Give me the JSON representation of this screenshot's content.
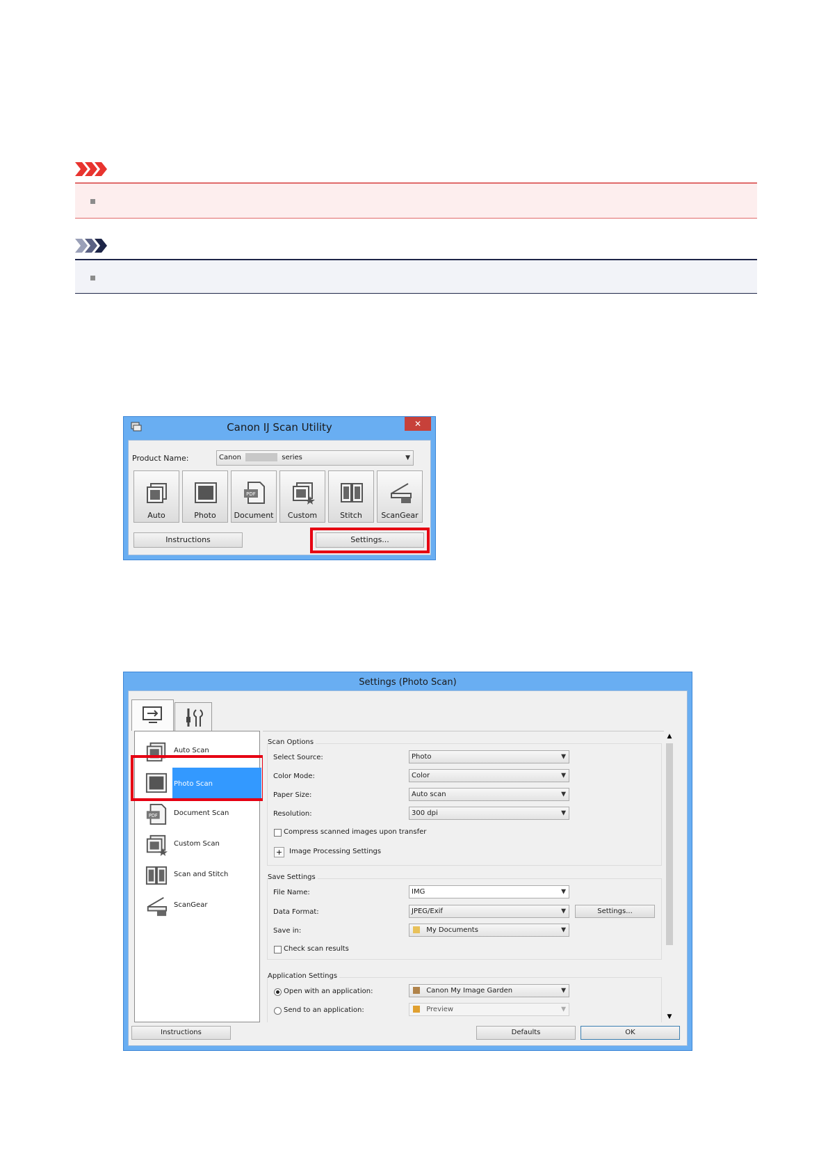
{
  "notices": {
    "important_icon": "important-arrows-icon",
    "note_icon": "note-arrows-icon",
    "important_color": "#e8342f",
    "note_color": "#1d2548"
  },
  "scan_utility": {
    "title": "Canon IJ Scan Utility",
    "close_glyph": "✕",
    "product_name_label": "Product Name:",
    "product_value_prefix": "Canon",
    "product_value_suffix": "series",
    "tiles": [
      {
        "label": "Auto",
        "icon": "auto-scan-icon"
      },
      {
        "label": "Photo",
        "icon": "photo-scan-icon"
      },
      {
        "label": "Document",
        "icon": "document-scan-icon"
      },
      {
        "label": "Custom",
        "icon": "custom-scan-icon"
      },
      {
        "label": "Stitch",
        "icon": "stitch-icon"
      },
      {
        "label": "ScanGear",
        "icon": "scangear-icon"
      }
    ],
    "instructions_label": "Instructions",
    "settings_label": "Settings..."
  },
  "settings_dialog": {
    "title": "Settings (Photo Scan)",
    "tabs": [
      {
        "icon": "scan-from-computer-icon",
        "selected": true
      },
      {
        "icon": "general-settings-icon",
        "selected": false
      }
    ],
    "sidebar": [
      {
        "label": "Auto Scan",
        "icon": "auto-scan-icon",
        "selected": false
      },
      {
        "label": "Photo Scan",
        "icon": "photo-scan-icon",
        "selected": true
      },
      {
        "label": "Document Scan",
        "icon": "document-scan-icon",
        "selected": false
      },
      {
        "label": "Custom Scan",
        "icon": "custom-scan-icon",
        "selected": false
      },
      {
        "label": "Scan and Stitch",
        "icon": "stitch-icon",
        "selected": false
      },
      {
        "label": "ScanGear",
        "icon": "scangear-icon",
        "selected": false
      }
    ],
    "scan_options": {
      "title": "Scan Options",
      "select_source_label": "Select Source:",
      "select_source_value": "Photo",
      "color_mode_label": "Color Mode:",
      "color_mode_value": "Color",
      "paper_size_label": "Paper Size:",
      "paper_size_value": "Auto scan",
      "resolution_label": "Resolution:",
      "resolution_value": "300 dpi",
      "compress_label": "Compress scanned images upon transfer",
      "compress_checked": false,
      "expand_glyph": "+",
      "image_processing_label": "Image Processing Settings"
    },
    "save_settings": {
      "title": "Save Settings",
      "file_name_label": "File Name:",
      "file_name_value": "IMG",
      "data_format_label": "Data Format:",
      "data_format_value": "JPEG/Exif",
      "format_settings_label": "Settings...",
      "save_in_label": "Save in:",
      "save_in_value": "My Documents",
      "check_results_label": "Check scan results",
      "check_results_checked": false
    },
    "application_settings": {
      "title": "Application Settings",
      "open_with_label": "Open with an application:",
      "open_with_value": "Canon My Image Garden",
      "open_with_selected": true,
      "send_to_label": "Send to an application:",
      "send_to_value": "Preview",
      "send_to_selected": false
    },
    "instructions_label": "Instructions",
    "defaults_label": "Defaults",
    "ok_label": "OK",
    "highlight_color": "#e60012",
    "selection_color": "#3399ff"
  }
}
